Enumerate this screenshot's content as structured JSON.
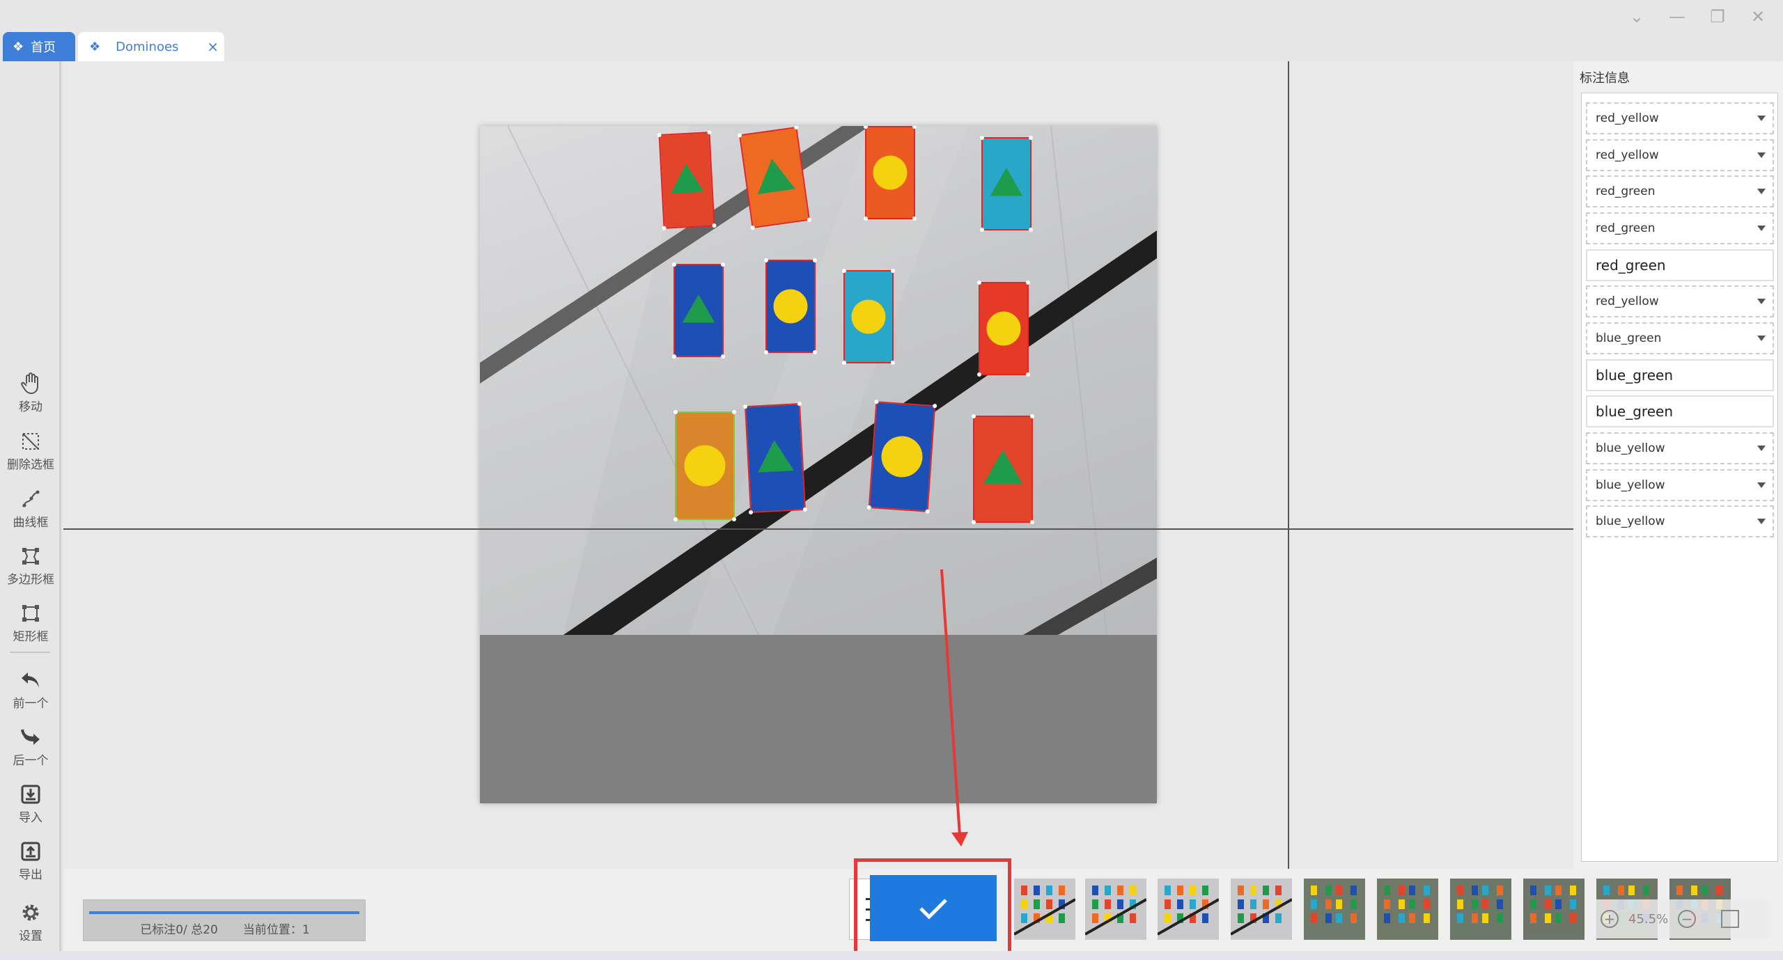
{
  "window": {
    "controls": [
      "⌄",
      "—",
      "❐",
      "✕"
    ]
  },
  "tabs": [
    {
      "icon": "❖",
      "label": "首页",
      "active": false
    },
    {
      "icon": "❖",
      "label": "Dominoes",
      "active": true,
      "close": "×"
    }
  ],
  "toolbar": {
    "move": "移动",
    "delete_box": "删除选框",
    "curve_box": "曲线框",
    "polygon_box": "多边形框",
    "rect_box": "矩形框",
    "prev": "前一个",
    "next": "后一个",
    "import": "导入",
    "export": "导出",
    "settings": "设置"
  },
  "panel": {
    "title": "标注信息",
    "labels": [
      {
        "text": "red_yellow",
        "dropdown": true
      },
      {
        "text": "red_yellow",
        "dropdown": true
      },
      {
        "text": "red_green",
        "dropdown": true
      },
      {
        "text": "red_green",
        "dropdown": true
      },
      {
        "text": "red_green",
        "dropdown": false
      },
      {
        "text": "red_yellow",
        "dropdown": true
      },
      {
        "text": "blue_green",
        "dropdown": true
      },
      {
        "text": "blue_green",
        "dropdown": false
      },
      {
        "text": "blue_green",
        "dropdown": false
      },
      {
        "text": "blue_yellow",
        "dropdown": true
      },
      {
        "text": "blue_yellow",
        "dropdown": true
      },
      {
        "text": "blue_yellow",
        "dropdown": true
      }
    ]
  },
  "status": {
    "labeled": "已标注0/ 总20",
    "position": "当前位置：1",
    "progress": 1.0
  },
  "zoom": {
    "level": "45.5%"
  },
  "colors": {
    "accent": "#1f7ae0",
    "tab_active": "#3d7fd9",
    "highlight": "#e53935",
    "box_red": "#e0252b",
    "box_green": "#8bc34a"
  },
  "dominoes": [
    {
      "color": "#e2452a",
      "shape": "triangle"
    },
    {
      "color": "#ee6a22",
      "shape": "triangle"
    },
    {
      "color": "#ec5a24",
      "shape": "circle"
    },
    {
      "color": "#28a7c9",
      "shape": "triangle"
    },
    {
      "color": "#1e4fb5",
      "shape": "triangle"
    },
    {
      "color": "#1e4fb5",
      "shape": "circle"
    },
    {
      "color": "#28a7c9",
      "shape": "circle"
    },
    {
      "color": "#e43a26",
      "shape": "circle"
    },
    {
      "color": "#d9852a",
      "shape": "circle"
    },
    {
      "color": "#1e4fb5",
      "shape": "triangle"
    },
    {
      "color": "#1e4fb5",
      "shape": "circle"
    },
    {
      "color": "#e2452a",
      "shape": "triangle"
    }
  ],
  "thumbnails_count": 10
}
